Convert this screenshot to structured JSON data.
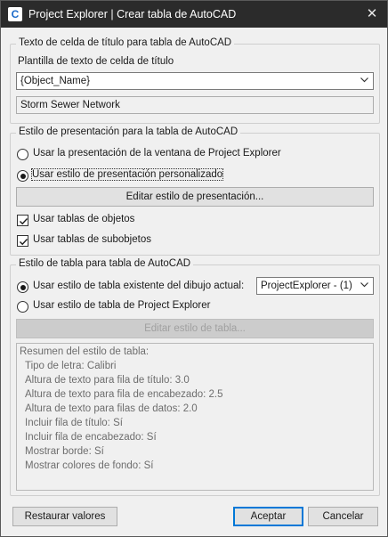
{
  "window": {
    "title": "Project Explorer | Crear tabla de AutoCAD",
    "close_glyph": "✕"
  },
  "title_cell_group": {
    "legend": "Texto de celda de título para tabla de AutoCAD",
    "template_label": "Plantilla de texto de celda de título",
    "template_value": "{Object_Name}",
    "preview_value": "Storm Sewer Network"
  },
  "presentation_group": {
    "legend": "Estilo de presentación para la tabla de AutoCAD",
    "option_window_label": "Usar la presentación de la ventana de Project Explorer",
    "option_window_checked": false,
    "option_custom_label": "Usar estilo de presentación personalizado",
    "option_custom_checked": true,
    "edit_button_label": "Editar estilo de presentación...",
    "object_tables_label": "Usar tablas de objetos",
    "object_tables_checked": true,
    "subobject_tables_label": "Usar tablas de subobjetos",
    "subobject_tables_checked": true
  },
  "table_style_group": {
    "legend": "Estilo de tabla para tabla de AutoCAD",
    "option_existing_label": "Usar estilo de tabla existente del dibujo actual:",
    "option_existing_checked": true,
    "existing_style_value": "ProjectExplorer - (1)",
    "option_pe_label": "Usar estilo de tabla de Project Explorer",
    "option_pe_checked": false,
    "edit_table_button_label": "Editar estilo de tabla...",
    "summary_lines": [
      "Resumen del estilo de tabla:",
      "Tipo de letra: Calibri",
      "Altura de texto para fila de título: 3.0",
      "Altura de texto para fila de encabezado: 2.5",
      "Altura de texto para filas de datos: 2.0",
      "Incluir fila de título: Sí",
      "Incluir fila de encabezado: Sí",
      "Mostrar borde: Sí",
      "Mostrar colores de fondo: Sí"
    ]
  },
  "footer": {
    "restore_label": "Restaurar valores",
    "accept_label": "Aceptar",
    "cancel_label": "Cancelar"
  }
}
